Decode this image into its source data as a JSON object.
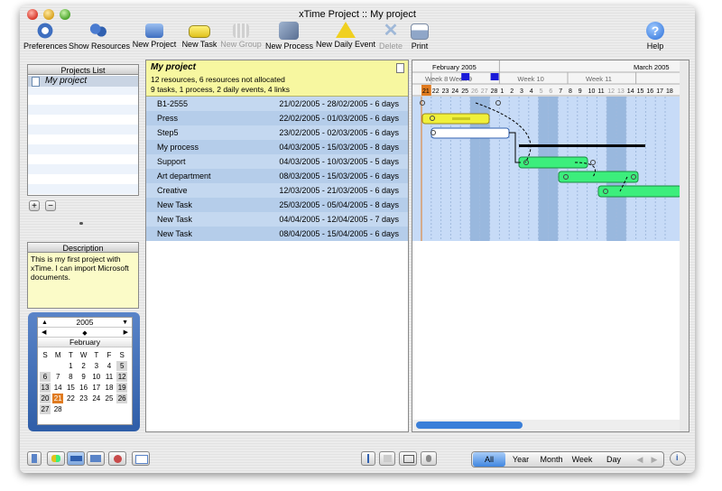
{
  "window": {
    "title": "xTime Project :: My project"
  },
  "toolbar": {
    "preferences": "Preferences",
    "show_resources": "Show Resources",
    "new_project": "New Project",
    "new_task": "New Task",
    "new_group": "New Group",
    "new_process": "New Process",
    "new_daily_event": "New Daily Event",
    "delete": "Delete",
    "print": "Print",
    "help": "Help"
  },
  "projects_panel": {
    "title": "Projects List",
    "items": [
      {
        "label": "My project"
      }
    ],
    "add_label": "+",
    "remove_label": "−"
  },
  "description_panel": {
    "title": "Description",
    "text": "This is my first project with xTime. I can import Microsoft documents."
  },
  "calendar": {
    "year": "2005",
    "month": "February",
    "weekdays": [
      "S",
      "M",
      "T",
      "W",
      "T",
      "F",
      "S"
    ],
    "weeks": [
      [
        "",
        "",
        "1",
        "2",
        "3",
        "4",
        "5"
      ],
      [
        "6",
        "7",
        "8",
        "9",
        "10",
        "11",
        "12"
      ],
      [
        "13",
        "14",
        "15",
        "16",
        "17",
        "18",
        "19"
      ],
      [
        "20",
        "21",
        "22",
        "23",
        "24",
        "25",
        "26"
      ],
      [
        "27",
        "28",
        "",
        "",
        "",
        "",
        ""
      ]
    ],
    "today": "21"
  },
  "project": {
    "name": "My project",
    "summary1": "12 resources, 6 resources not allocated",
    "summary2": "9 tasks, 1 process, 2 daily events, 4 links"
  },
  "tasks": [
    {
      "name": "B1-2555",
      "dates": "21/02/2005 - 28/02/2005 - 6 days"
    },
    {
      "name": "Press",
      "dates": "22/02/2005 - 01/03/2005 - 6 days"
    },
    {
      "name": "Step5",
      "dates": "23/02/2005 - 02/03/2005 - 6 days"
    },
    {
      "name": "My process",
      "dates": "04/03/2005 - 15/03/2005 - 8 days"
    },
    {
      "name": "Support",
      "dates": "04/03/2005 - 10/03/2005 - 5 days"
    },
    {
      "name": "Art department",
      "dates": "08/03/2005 - 15/03/2005 - 6 days"
    },
    {
      "name": "Creative",
      "dates": "12/03/2005 - 21/03/2005 - 6 days"
    },
    {
      "name": "New Task",
      "dates": "25/03/2005 - 05/04/2005 - 8 days"
    },
    {
      "name": "New Task",
      "dates": "04/04/2005 - 12/04/2005 - 7 days"
    },
    {
      "name": "New Task",
      "dates": "08/04/2005 - 15/04/2005 - 6 days"
    }
  ],
  "gantt": {
    "months": [
      "February 2005",
      "March 2005"
    ],
    "weeks": [
      "Week 8",
      "Week 9",
      "Week 10",
      "Week 11"
    ],
    "days": [
      "21",
      "22",
      "23",
      "24",
      "25",
      "26",
      "27",
      "28",
      "1",
      "2",
      "3",
      "4",
      "5",
      "6",
      "7",
      "8",
      "9",
      "10",
      "11",
      "12",
      "13",
      "14",
      "15",
      "16",
      "17",
      "18"
    ]
  },
  "bottom": {
    "views": [
      "All",
      "Year",
      "Month",
      "Week",
      "Day"
    ],
    "selected_view": "All"
  },
  "colors": {
    "task_yellow": "#f0f03a",
    "task_green": "#3cee7c",
    "today": "#e07b20",
    "event_blue": "#1a1ad8",
    "row_blue": "#c4d8f0"
  }
}
